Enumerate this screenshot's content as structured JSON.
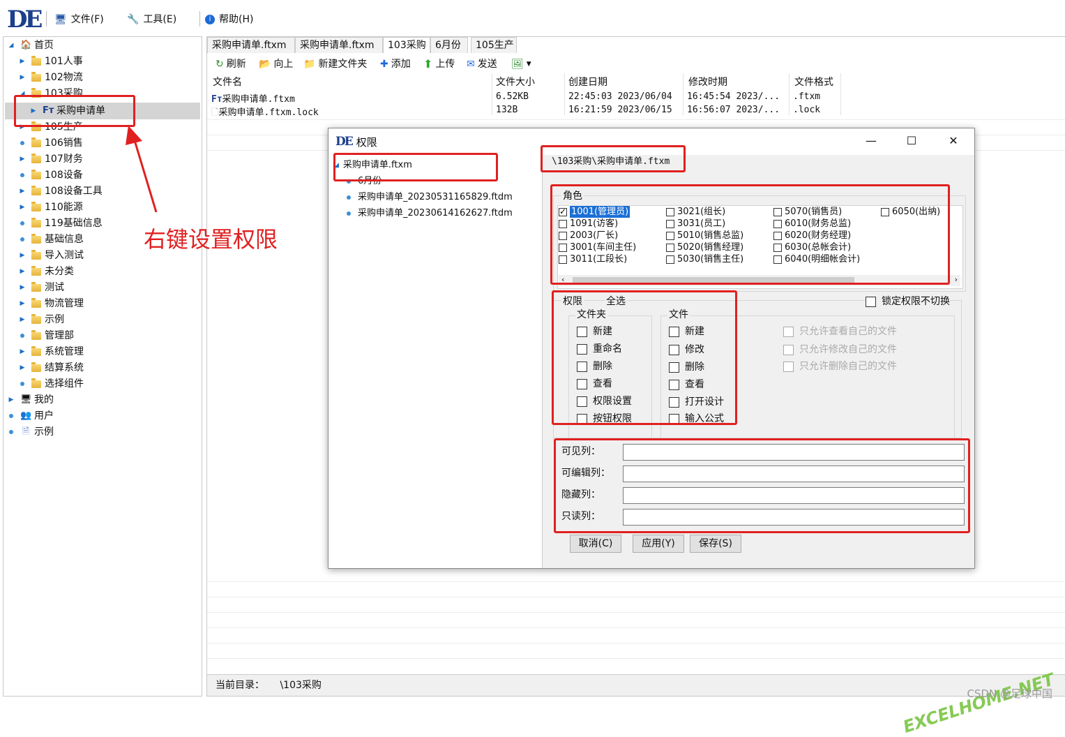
{
  "app": {
    "logo": "DE"
  },
  "menu": {
    "file": "文件(F)",
    "tools": "工具(E)",
    "help": "帮助(H)"
  },
  "tree": {
    "items": [
      {
        "label": "首页"
      },
      {
        "label": "101人事"
      },
      {
        "label": "102物流"
      },
      {
        "label": "103采购"
      },
      {
        "label": "采购申请单"
      },
      {
        "label": "105生产"
      },
      {
        "label": "106销售"
      },
      {
        "label": "107财务"
      },
      {
        "label": "108设备"
      },
      {
        "label": "108设备工具"
      },
      {
        "label": "110能源"
      },
      {
        "label": "119基础信息"
      },
      {
        "label": "基础信息"
      },
      {
        "label": "导入测试"
      },
      {
        "label": "未分类"
      },
      {
        "label": "测试"
      },
      {
        "label": "物流管理"
      },
      {
        "label": "示例"
      },
      {
        "label": "管理部"
      },
      {
        "label": "系统管理"
      },
      {
        "label": "结算系统"
      },
      {
        "label": "选择组件"
      },
      {
        "label": "我的"
      },
      {
        "label": "用户"
      },
      {
        "label": "示例"
      }
    ]
  },
  "tabs": [
    "采购申请单.ftxm",
    "采购申请单.ftxm",
    "103采购",
    "6月份",
    "105生产"
  ],
  "toolbar": {
    "refresh": "刷新",
    "up": "向上",
    "new_folder": "新建文件夹",
    "add": "添加",
    "upload": "上传",
    "send": "发送"
  },
  "files": {
    "columns": [
      "文件名",
      "文件大小",
      "创建日期",
      "修改时期",
      "文件格式"
    ],
    "rows": [
      [
        "采购申请单.ftxm",
        "6.52KB",
        "22:45:03 2023/06/04",
        "16:45:54 2023/...",
        ".ftxm"
      ],
      [
        "采购申请单.ftxm.lock",
        "132B",
        "16:21:59 2023/06/15",
        "16:56:07 2023/...",
        ".lock"
      ]
    ]
  },
  "status": {
    "label": "当前目录：",
    "value": "\\103采购"
  },
  "dialog": {
    "title": "权限",
    "tree": [
      "采购申请单.ftxm",
      "6月份",
      "采购申请单_20230531165829.ftdm",
      "采购申请单_20230614162627.ftdm"
    ],
    "path": "\\103采购\\采购申请单.ftxm",
    "roles_label": "角色",
    "roles": [
      {
        "label": "1001(管理员)",
        "checked": true
      },
      {
        "label": "1091(访客)",
        "checked": false
      },
      {
        "label": "2003(厂长)",
        "checked": false
      },
      {
        "label": "3001(车间主任)",
        "checked": false
      },
      {
        "label": "3011(工段长)",
        "checked": false
      },
      {
        "label": "3021(组长)",
        "checked": false
      },
      {
        "label": "3031(员工)",
        "checked": false
      },
      {
        "label": "5010(销售总监)",
        "checked": false
      },
      {
        "label": "5020(销售经理)",
        "checked": false
      },
      {
        "label": "5030(销售主任)",
        "checked": false
      },
      {
        "label": "5070(销售员)",
        "checked": false
      },
      {
        "label": "6010(财务总监)",
        "checked": false
      },
      {
        "label": "6020(财务经理)",
        "checked": false
      },
      {
        "label": "6030(总帐会计)",
        "checked": false
      },
      {
        "label": "6040(明细帐会计)",
        "checked": false
      },
      {
        "label": "6050(出纳)",
        "checked": false
      }
    ],
    "perm_label": "权限",
    "select_all": "全选",
    "lock_label": "锁定权限不切换",
    "folder_group": "文件夹",
    "folder_perms": [
      "新建",
      "重命名",
      "删除",
      "查看",
      "权限设置",
      "按钮权限"
    ],
    "file_group": "文件",
    "file_perms": [
      "新建",
      "修改",
      "删除",
      "查看",
      "打开设计",
      "输入公式"
    ],
    "own_perms": [
      "只允许查看自己的文件",
      "只允许修改自己的文件",
      "只允许删除自己的文件"
    ],
    "fields": [
      "可见列：",
      "可编辑列：",
      "隐藏列：",
      "只读列："
    ],
    "buttons": {
      "cancel": "取消(C)",
      "apply": "应用(Y)",
      "save": "保存(S)"
    }
  },
  "annotation": "右键设置权限",
  "watermark": {
    "site": "EXCELHOME.NET",
    "credit": "CSDN @足球中国"
  }
}
